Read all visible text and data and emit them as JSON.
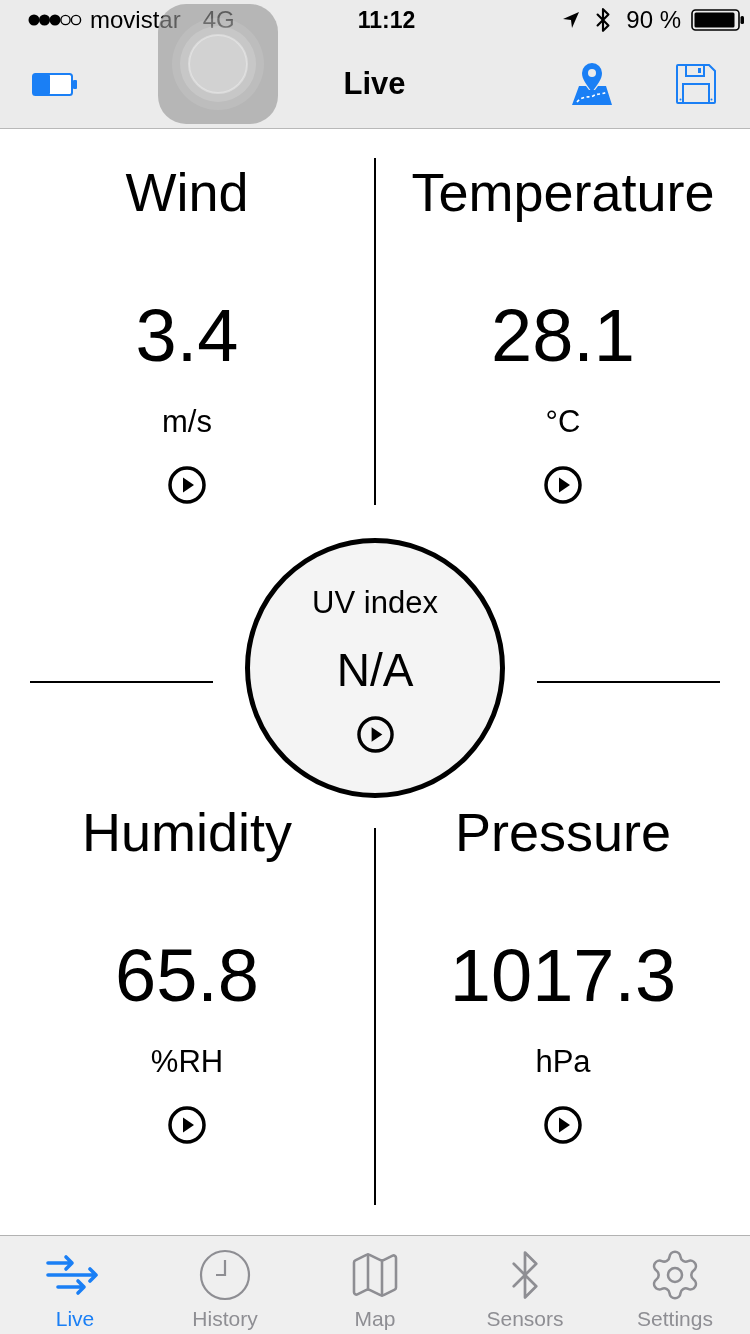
{
  "status_bar": {
    "carrier": "movistar",
    "network": "4G",
    "time": "11:12",
    "battery": "90 %"
  },
  "nav_bar": {
    "title": "Live"
  },
  "readings": [
    {
      "title": "Wind",
      "value": "3.4",
      "unit": "m/s"
    },
    {
      "title": "Temperature",
      "value": "28.1",
      "unit": "°C"
    },
    {
      "title": "Humidity",
      "value": "65.8",
      "unit": "%RH"
    },
    {
      "title": "Pressure",
      "value": "1017.3",
      "unit": "hPa"
    }
  ],
  "uv": {
    "title": "UV index",
    "value": "N/A"
  },
  "tab_bar": [
    {
      "label": "Live",
      "selected": true
    },
    {
      "label": "History",
      "selected": false
    },
    {
      "label": "Map",
      "selected": false
    },
    {
      "label": "Sensors",
      "selected": false
    },
    {
      "label": "Settings",
      "selected": false
    }
  ]
}
